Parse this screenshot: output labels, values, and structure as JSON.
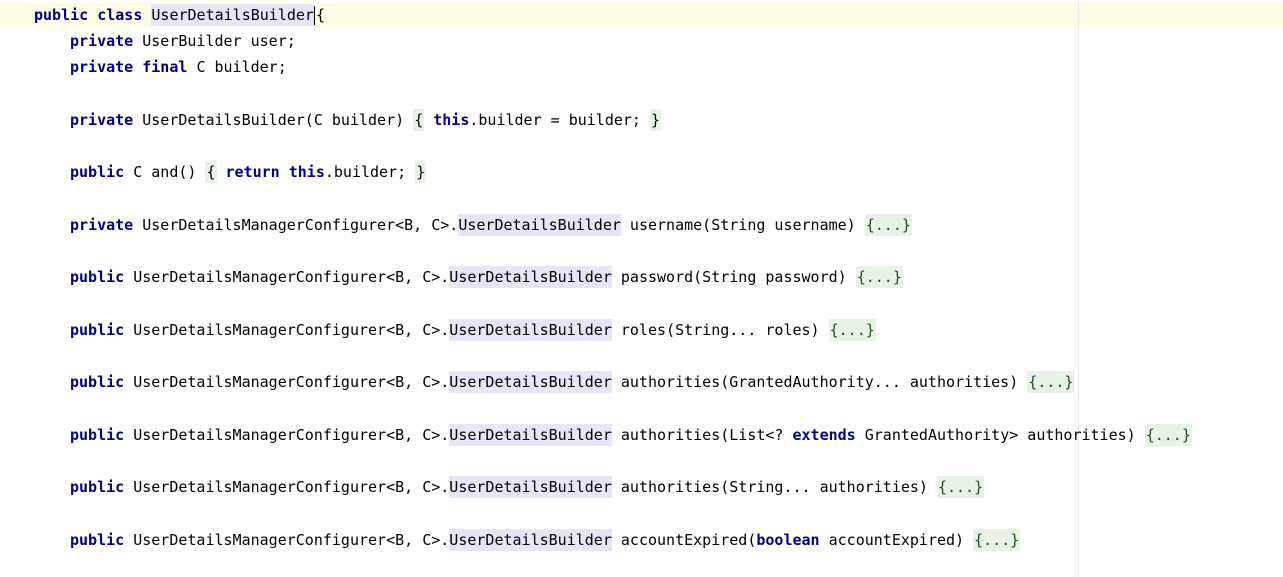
{
  "editor": {
    "lines": [
      {
        "kw1": "public",
        "kw2": "class",
        "class_name": "UserDetailsBuilder",
        "brace": "{"
      },
      {
        "kw1": "private",
        "text": "UserBuilder user;"
      },
      {
        "kw1": "private",
        "kw2": "final",
        "text": "C builder;"
      },
      {
        "kw1": "private",
        "signature": "UserDetailsBuilder(C builder)",
        "open": "{",
        "kw_this": "this",
        "body": ".builder = builder;",
        "close": "}"
      },
      {
        "kw1": "public",
        "signature": "C and()",
        "open": "{",
        "kw_return": "return",
        "kw_this": "this",
        "body": ".builder;",
        "close": "}"
      },
      {
        "kw1": "private",
        "type_prefix": "UserDetailsManagerConfigurer<B, C>.",
        "type_name": "UserDetailsBuilder",
        "method": "username(String username)",
        "fold": "{...}"
      },
      {
        "kw1": "public",
        "type_prefix": "UserDetailsManagerConfigurer<B, C>.",
        "type_name": "UserDetailsBuilder",
        "method": "password(String password)",
        "fold": "{...}"
      },
      {
        "kw1": "public",
        "type_prefix": "UserDetailsManagerConfigurer<B, C>.",
        "type_name": "UserDetailsBuilder",
        "method": "roles(String... roles)",
        "fold": "{...}"
      },
      {
        "kw1": "public",
        "type_prefix": "UserDetailsManagerConfigurer<B, C>.",
        "type_name": "UserDetailsBuilder",
        "method": "authorities(GrantedAuthority... authorities)",
        "fold": "{...}"
      },
      {
        "kw1": "public",
        "type_prefix": "UserDetailsManagerConfigurer<B, C>.",
        "type_name": "UserDetailsBuilder",
        "method_pre": "authorities(List<? ",
        "kw_mid": "extends",
        "method_post": " GrantedAuthority> authorities)",
        "fold": "{...}"
      },
      {
        "kw1": "public",
        "type_prefix": "UserDetailsManagerConfigurer<B, C>.",
        "type_name": "UserDetailsBuilder",
        "method": "authorities(String... authorities)",
        "fold": "{...}"
      },
      {
        "kw1": "public",
        "type_prefix": "UserDetailsManagerConfigurer<B, C>.",
        "type_name": "UserDetailsBuilder",
        "method_pre": "accountExpired(",
        "kw_mid": "boolean",
        "method_post": " accountExpired)",
        "fold": "{...}"
      }
    ]
  },
  "colors": {
    "keyword": "#000080",
    "caret_line": "#fefce6",
    "usage_highlight": "#e6e6f8",
    "fold_background": "#e8f2e6",
    "fold_text": "#254d28"
  }
}
